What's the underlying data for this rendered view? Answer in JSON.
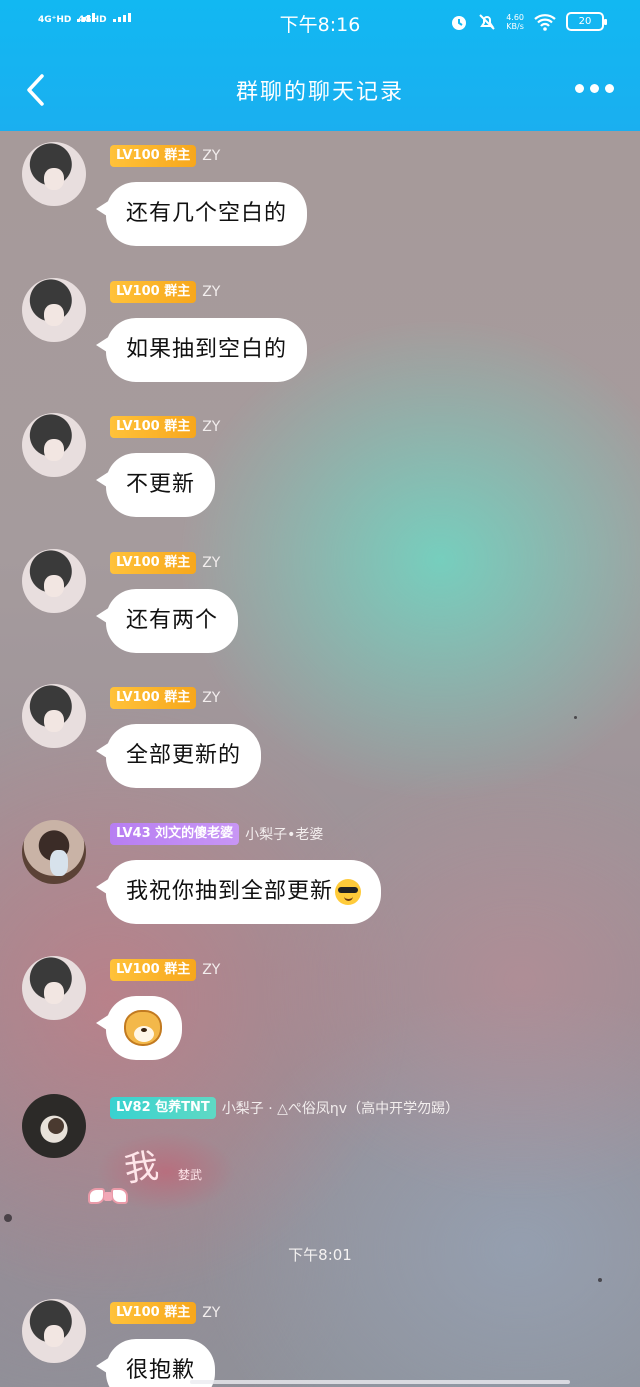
{
  "status_bar": {
    "signal_1": "4G⁺HD",
    "signal_2": "4GHD",
    "time": "下午8:16",
    "net_speed": "4.60",
    "net_unit": "KB/s",
    "battery": "20"
  },
  "header": {
    "title": "群聊的聊天记录"
  },
  "messages": [
    {
      "badge": "LV100 群主",
      "nick": "ZY",
      "text": "还有几个空白的"
    },
    {
      "badge": "LV100 群主",
      "nick": "ZY",
      "text": "如果抽到空白的"
    },
    {
      "badge": "LV100 群主",
      "nick": "ZY",
      "text": "不更新"
    },
    {
      "badge": "LV100 群主",
      "nick": "ZY",
      "text": "还有两个"
    },
    {
      "badge": "LV100 群主",
      "nick": "ZY",
      "text": "全部更新的"
    },
    {
      "badge": "LV43 刘文的傻老婆",
      "nick": "小梨子•老婆",
      "text": "我祝你抽到全部更新"
    },
    {
      "badge": "LV100 群主",
      "nick": "ZY",
      "text": ""
    },
    {
      "badge": "LV82 包养TNT",
      "nick": "小梨子 · △ぺ俗凤ηv（高中开学勿踢）",
      "sticker_big": "我",
      "sticker_small": "婪武"
    },
    {
      "badge": "LV100 群主",
      "nick": "ZY",
      "text": "很抱歉"
    }
  ],
  "timestamp": "下午8:01",
  "icons": {
    "back": "chevron-left-icon",
    "more": "more-dots-icon",
    "alarm": "alarm-icon",
    "mute": "bell-off-icon",
    "wifi": "wifi-icon",
    "battery": "battery-icon",
    "emoji_cool": "sunglasses-emoji-icon",
    "sticker_dog": "shiba-sticker-icon",
    "bow": "bow-icon"
  },
  "colors": {
    "header": "#12b8f2",
    "badge_owner": "#f7a71c",
    "badge_purple": "#b77ef2",
    "badge_teal": "#38d2d0",
    "bubble": "#ffffff"
  }
}
